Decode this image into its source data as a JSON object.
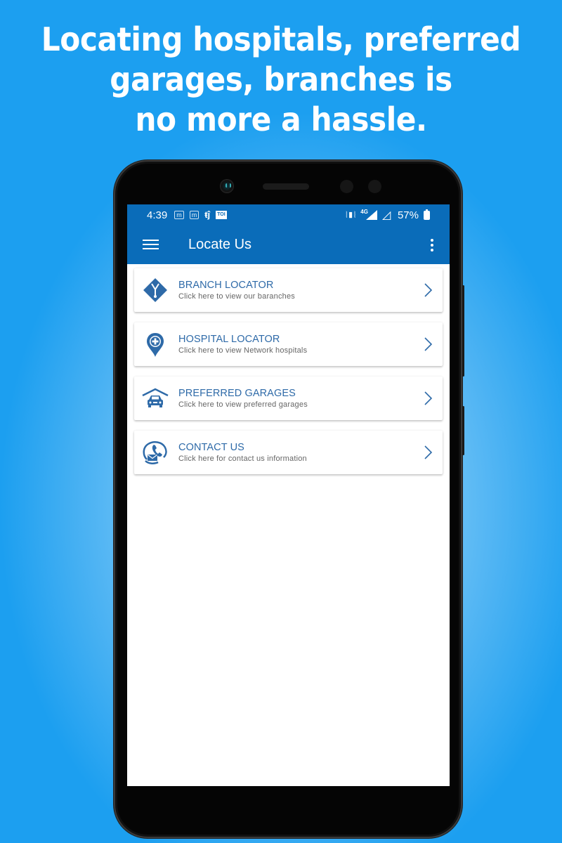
{
  "headline": {
    "lines": [
      "Locating hospitals, preferred",
      "garages, branches is",
      "no more a hassle."
    ]
  },
  "status_bar": {
    "time": "4:39",
    "notification_icons": [
      "m",
      "m",
      "teams",
      "TOI"
    ],
    "network_label": "4G",
    "battery": "57%"
  },
  "app_bar": {
    "title": "Locate Us"
  },
  "menu_items": [
    {
      "title": "BRANCH LOCATOR",
      "subtitle": "Click here to view our baranches",
      "icon": "branch-icon"
    },
    {
      "title": "HOSPITAL LOCATOR",
      "subtitle": "Click here to view Network hospitals",
      "icon": "hospital-pin-icon"
    },
    {
      "title": "PREFERRED GARAGES",
      "subtitle": "Click here to view preferred garages",
      "icon": "garage-car-icon"
    },
    {
      "title": "CONTACT US",
      "subtitle": "Click here for contact us information",
      "icon": "contact-phone-mail-icon"
    }
  ],
  "colors": {
    "primary": "#0a6cb9",
    "title_text": "#2e6aa8",
    "subtitle_text": "#666666",
    "icon_blue": "#2e6aa8"
  }
}
